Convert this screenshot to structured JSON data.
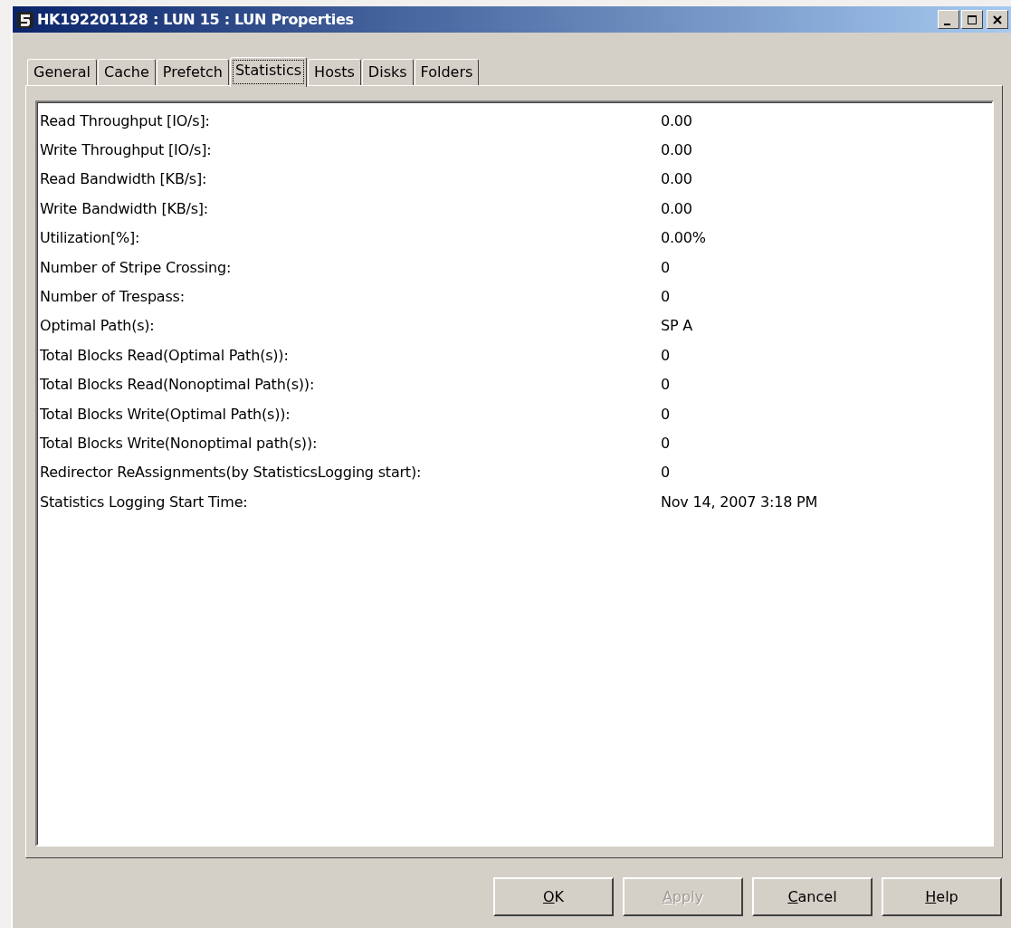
{
  "window": {
    "title": "HK192201128 : LUN 15 : LUN Properties"
  },
  "tabs": [
    {
      "label": "General",
      "selected": false
    },
    {
      "label": "Cache",
      "selected": false
    },
    {
      "label": "Prefetch",
      "selected": false
    },
    {
      "label": "Statistics",
      "selected": true
    },
    {
      "label": "Hosts",
      "selected": false
    },
    {
      "label": "Disks",
      "selected": false
    },
    {
      "label": "Folders",
      "selected": false
    }
  ],
  "statistics": [
    {
      "label": "Read Throughput [IO/s]:",
      "value": "0.00"
    },
    {
      "label": "Write Throughput [IO/s]:",
      "value": "0.00"
    },
    {
      "label": "Read Bandwidth [KB/s]:",
      "value": "0.00"
    },
    {
      "label": "Write Bandwidth [KB/s]:",
      "value": "0.00"
    },
    {
      "label": "Utilization[%]:",
      "value": "0.00%"
    },
    {
      "label": "Number of Stripe Crossing:",
      "value": "0"
    },
    {
      "label": "Number of Trespass:",
      "value": "0"
    },
    {
      "label": "Optimal Path(s):",
      "value": "SP A"
    },
    {
      "label": "Total Blocks Read(Optimal Path(s)):",
      "value": "0"
    },
    {
      "label": "Total Blocks Read(Nonoptimal Path(s)):",
      "value": "0"
    },
    {
      "label": "Total Blocks Write(Optimal Path(s)):",
      "value": "0"
    },
    {
      "label": "Total Blocks Write(Nonoptimal path(s)):",
      "value": "0"
    },
    {
      "label": "Redirector ReAssignments(by StatisticsLogging start):",
      "value": "0"
    },
    {
      "label": "Statistics Logging Start Time:",
      "value": "Nov 14, 2007 3:18 PM"
    }
  ],
  "buttons": [
    {
      "mnemonic": "O",
      "rest": "K",
      "disabled": false
    },
    {
      "mnemonic": "A",
      "rest": "pply",
      "disabled": true
    },
    {
      "mnemonic": "C",
      "rest": "ancel",
      "disabled": false
    },
    {
      "mnemonic": "H",
      "rest": "elp",
      "disabled": false
    }
  ]
}
